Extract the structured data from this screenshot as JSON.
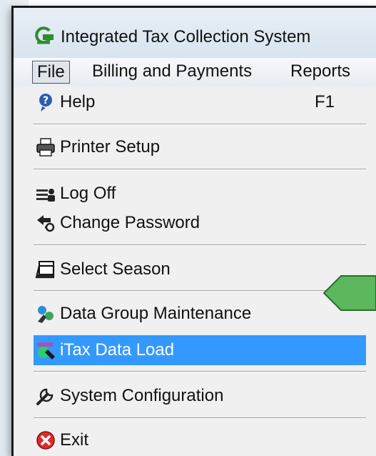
{
  "window": {
    "title": "Integrated Tax Collection System",
    "app_icon": "green-g-logo-icon"
  },
  "menubar": [
    {
      "label": "File"
    },
    {
      "label": "Billing and Payments"
    },
    {
      "label": "Reports"
    }
  ],
  "file_menu": [
    {
      "label": "Help",
      "accel": "F1",
      "icon": "help-icon"
    },
    {
      "label": "Printer Setup",
      "icon": "printer-icon"
    },
    {
      "label": "Log Off",
      "icon": "log-off-icon"
    },
    {
      "label": "Change Password",
      "icon": "change-password-icon"
    },
    {
      "label": "Select Season",
      "icon": "select-season-icon"
    },
    {
      "label": "Data Group Maintenance",
      "icon": "data-group-icon"
    },
    {
      "label": "iTax Data Load",
      "icon": "itax-data-load-icon",
      "highlighted": true
    },
    {
      "label": "System Configuration",
      "icon": "wrench-icon"
    },
    {
      "label": "Exit",
      "icon": "exit-icon"
    }
  ],
  "colors": {
    "highlight": "#3399ff",
    "arrow": "#5cb85c"
  }
}
